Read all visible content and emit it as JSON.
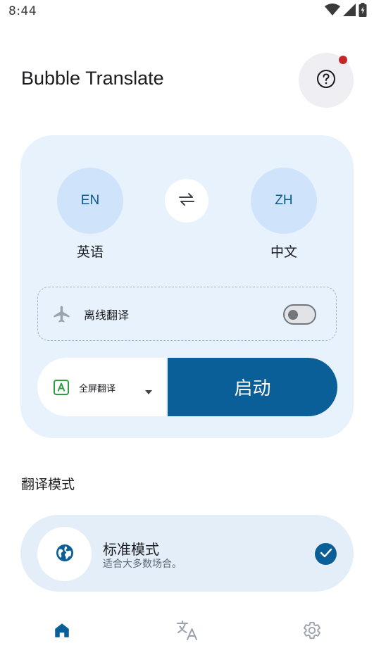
{
  "status_bar": {
    "time": "8:44",
    "icons": [
      "wifi-icon",
      "signal-icon",
      "battery-icon"
    ]
  },
  "header": {
    "title": "Bubble Translate",
    "help_icon": "help-circle-icon",
    "has_notification_dot": true
  },
  "languages": {
    "source": {
      "code": "EN",
      "name": "英语"
    },
    "target": {
      "code": "ZH",
      "name": "中文"
    },
    "swap_icon": "swap-arrows-icon"
  },
  "offline": {
    "label": "离线翻译",
    "icon": "airplane-icon",
    "enabled": false
  },
  "launch": {
    "mode_label": "全屏翻译",
    "mode_icon": "fullscreen-translate-icon",
    "start_label": "启动"
  },
  "translation_mode": {
    "section_title": "翻译模式",
    "items": [
      {
        "name": "标准模式",
        "description": "适合大多数场合。",
        "icon": "globe-icon",
        "selected": true
      }
    ]
  },
  "bottom_nav": {
    "items": [
      {
        "icon": "home-icon",
        "active": true
      },
      {
        "icon": "translate-icon",
        "active": false
      },
      {
        "icon": "settings-gear-icon",
        "active": false
      }
    ]
  },
  "colors": {
    "primary": "#0b5f98",
    "card_bg": "#e7f2fd",
    "lang_circle": "#cfe4fb",
    "notification_dot": "#c62828",
    "icon_grey": "#9aa3ad"
  }
}
